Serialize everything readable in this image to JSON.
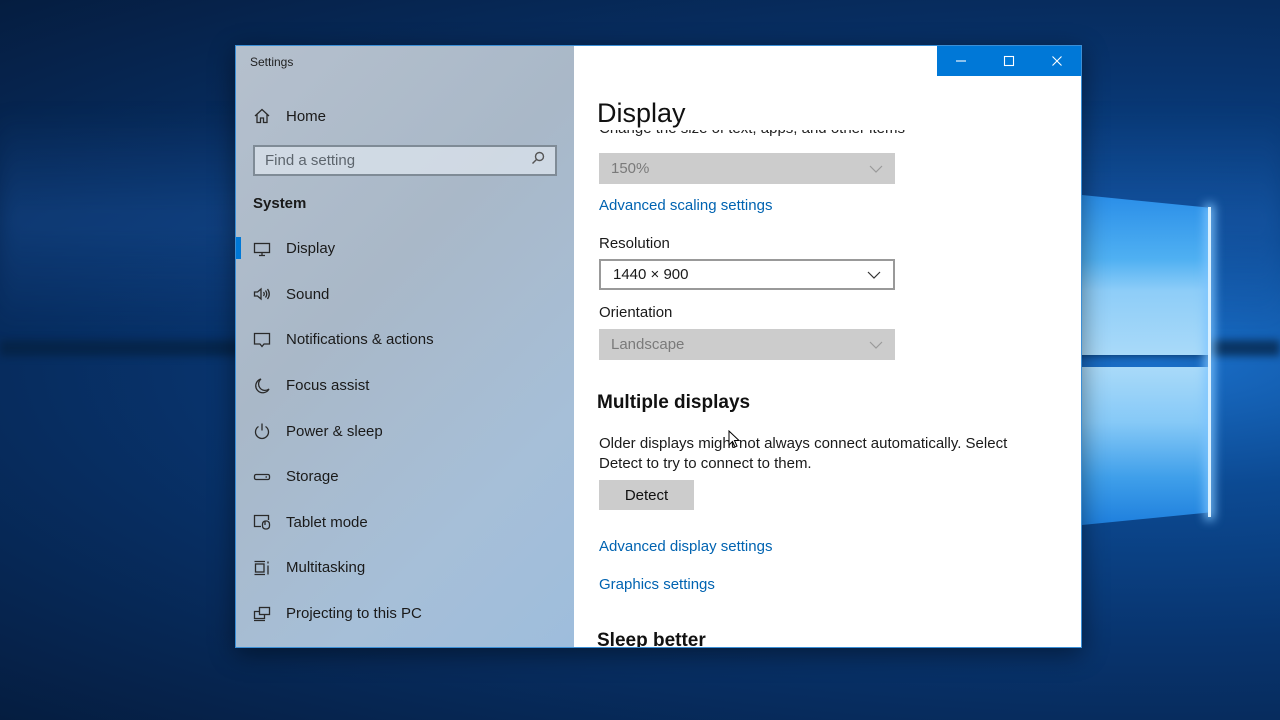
{
  "window": {
    "app_title": "Settings",
    "controls": {
      "minimize_icon": "minimize-icon",
      "maximize_icon": "maximize-icon",
      "close_icon": "close-icon"
    }
  },
  "sidebar": {
    "home": {
      "label": "Home",
      "icon": "home-icon"
    },
    "search": {
      "placeholder": "Find a setting",
      "value": "",
      "icon": "search-icon"
    },
    "section_title": "System",
    "items": [
      {
        "label": "Display",
        "icon": "monitor-icon",
        "active": true
      },
      {
        "label": "Sound",
        "icon": "speaker-icon",
        "active": false
      },
      {
        "label": "Notifications & actions",
        "icon": "notification-icon",
        "active": false
      },
      {
        "label": "Focus assist",
        "icon": "moon-icon",
        "active": false
      },
      {
        "label": "Power & sleep",
        "icon": "power-icon",
        "active": false
      },
      {
        "label": "Storage",
        "icon": "storage-drive-icon",
        "active": false
      },
      {
        "label": "Tablet mode",
        "icon": "tablet-mode-icon",
        "active": false
      },
      {
        "label": "Multitasking",
        "icon": "multitasking-icon",
        "active": false
      },
      {
        "label": "Projecting to this PC",
        "icon": "projecting-icon",
        "active": false
      }
    ],
    "accent_color": "#0078d7"
  },
  "content": {
    "page_title": "Display",
    "scale_label_clipped": "Change the size of text, apps, and other items",
    "scale": {
      "value": "150%",
      "disabled": true
    },
    "advanced_scaling_link": "Advanced scaling settings",
    "resolution": {
      "label": "Resolution",
      "value": "1440 × 900",
      "disabled": false
    },
    "orientation": {
      "label": "Orientation",
      "value": "Landscape",
      "disabled": true
    },
    "multiple_displays": {
      "heading": "Multiple displays",
      "description": "Older displays might not always connect automatically. Select Detect to try to connect to them.",
      "detect_button": "Detect"
    },
    "advanced_display_link": "Advanced display settings",
    "graphics_link": "Graphics settings",
    "sleep_heading": "Sleep better",
    "link_color": "#0063b1"
  }
}
